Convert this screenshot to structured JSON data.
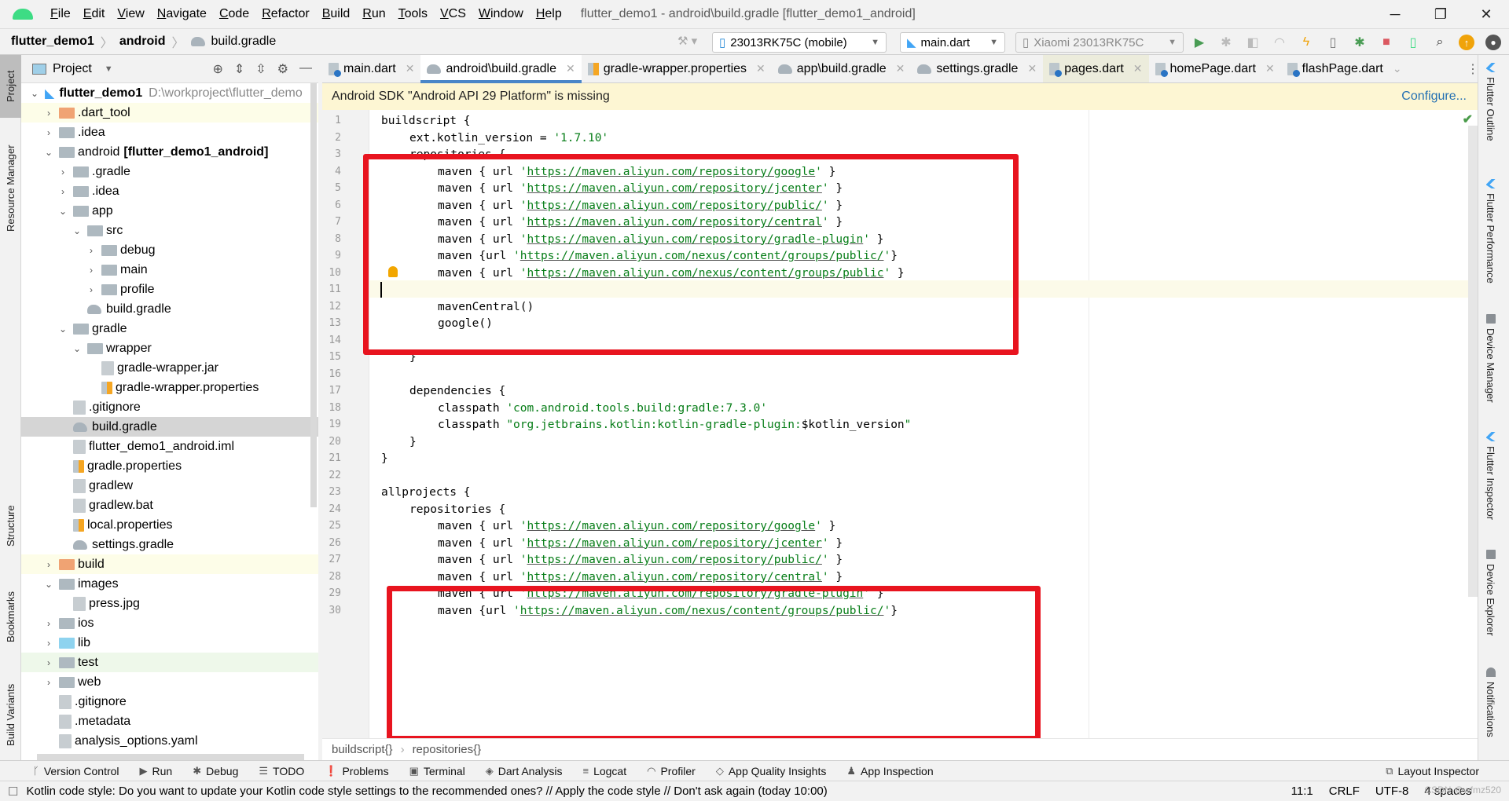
{
  "titlebar": {
    "menu": [
      "File",
      "Edit",
      "View",
      "Navigate",
      "Code",
      "Refactor",
      "Build",
      "Run",
      "Tools",
      "VCS",
      "Window",
      "Help"
    ],
    "window_title": "flutter_demo1 - android\\build.gradle [flutter_demo1_android]"
  },
  "navbar": {
    "breadcrumb": [
      "flutter_demo1",
      "android",
      "build.gradle"
    ],
    "device_combo": "23013RK75C (mobile)",
    "config_combo": "main.dart",
    "target_combo": "Xiaomi 23013RK75C"
  },
  "project_panel": {
    "title": "Project",
    "root_path": "D:\\workproject\\flutter_demo",
    "tree": [
      {
        "label": "flutter_demo1",
        "depth": 0,
        "arrow": "v",
        "icon": "flutter",
        "bold": true
      },
      {
        "label": ".dart_tool",
        "depth": 1,
        "arrow": ">",
        "icon": "folder-orange",
        "hl": "yellow"
      },
      {
        "label": ".idea",
        "depth": 1,
        "arrow": ">",
        "icon": "folder"
      },
      {
        "label": "android",
        "suffix": "[flutter_demo1_android]",
        "depth": 1,
        "arrow": "v",
        "icon": "folder"
      },
      {
        "label": ".gradle",
        "depth": 2,
        "arrow": ">",
        "icon": "folder"
      },
      {
        "label": ".idea",
        "depth": 2,
        "arrow": ">",
        "icon": "folder"
      },
      {
        "label": "app",
        "depth": 2,
        "arrow": "v",
        "icon": "folder"
      },
      {
        "label": "src",
        "depth": 3,
        "arrow": "v",
        "icon": "folder"
      },
      {
        "label": "debug",
        "depth": 4,
        "arrow": ">",
        "icon": "folder"
      },
      {
        "label": "main",
        "depth": 4,
        "arrow": ">",
        "icon": "folder"
      },
      {
        "label": "profile",
        "depth": 4,
        "arrow": ">",
        "icon": "folder"
      },
      {
        "label": "build.gradle",
        "depth": 3,
        "arrow": "",
        "icon": "gradle"
      },
      {
        "label": "gradle",
        "depth": 2,
        "arrow": "v",
        "icon": "folder"
      },
      {
        "label": "wrapper",
        "depth": 3,
        "arrow": "v",
        "icon": "folder"
      },
      {
        "label": "gradle-wrapper.jar",
        "depth": 4,
        "arrow": "",
        "icon": "file"
      },
      {
        "label": "gradle-wrapper.properties",
        "depth": 4,
        "arrow": "",
        "icon": "props"
      },
      {
        "label": ".gitignore",
        "depth": 2,
        "arrow": "",
        "icon": "file"
      },
      {
        "label": "build.gradle",
        "depth": 2,
        "arrow": "",
        "icon": "gradle",
        "sel": true
      },
      {
        "label": "flutter_demo1_android.iml",
        "depth": 2,
        "arrow": "",
        "icon": "file"
      },
      {
        "label": "gradle.properties",
        "depth": 2,
        "arrow": "",
        "icon": "props"
      },
      {
        "label": "gradlew",
        "depth": 2,
        "arrow": "",
        "icon": "file"
      },
      {
        "label": "gradlew.bat",
        "depth": 2,
        "arrow": "",
        "icon": "file"
      },
      {
        "label": "local.properties",
        "depth": 2,
        "arrow": "",
        "icon": "props"
      },
      {
        "label": "settings.gradle",
        "depth": 2,
        "arrow": "",
        "icon": "gradle"
      },
      {
        "label": "build",
        "depth": 1,
        "arrow": ">",
        "icon": "folder-orange",
        "hl": "yellow"
      },
      {
        "label": "images",
        "depth": 1,
        "arrow": "v",
        "icon": "folder"
      },
      {
        "label": "press.jpg",
        "depth": 2,
        "arrow": "",
        "icon": "file"
      },
      {
        "label": "ios",
        "depth": 1,
        "arrow": ">",
        "icon": "folder"
      },
      {
        "label": "lib",
        "depth": 1,
        "arrow": ">",
        "icon": "folder-blue"
      },
      {
        "label": "test",
        "depth": 1,
        "arrow": ">",
        "icon": "folder",
        "hl": "green"
      },
      {
        "label": "web",
        "depth": 1,
        "arrow": ">",
        "icon": "folder"
      },
      {
        "label": ".gitignore",
        "depth": 1,
        "arrow": "",
        "icon": "file"
      },
      {
        "label": ".metadata",
        "depth": 1,
        "arrow": "",
        "icon": "file"
      },
      {
        "label": "analysis_options.yaml",
        "depth": 1,
        "arrow": "",
        "icon": "file"
      }
    ]
  },
  "left_strip": [
    "Project",
    "Resource Manager",
    "Structure",
    "Bookmarks",
    "Build Variants"
  ],
  "tabs": [
    {
      "label": "main.dart",
      "icon": "dart"
    },
    {
      "label": "android\\build.gradle",
      "icon": "gradle",
      "active": true
    },
    {
      "label": "gradle-wrapper.properties",
      "icon": "props"
    },
    {
      "label": "app\\build.gradle",
      "icon": "gradle"
    },
    {
      "label": "settings.gradle",
      "icon": "gradle"
    },
    {
      "label": "pages.dart",
      "icon": "dart",
      "highlight": true
    },
    {
      "label": "homePage.dart",
      "icon": "dart"
    },
    {
      "label": "flashPage.dart",
      "icon": "dart"
    }
  ],
  "banner": {
    "text": "Android SDK \"Android API 29 Platform\" is missing",
    "action": "Configure..."
  },
  "code": [
    {
      "n": 1,
      "t": [
        [
          "",
          "buildscript {"
        ]
      ],
      "ind": 0
    },
    {
      "n": 2,
      "t": [
        [
          "",
          "ext.kotlin_version = "
        ],
        [
          "s",
          "'1.7.10'"
        ]
      ],
      "ind": 1
    },
    {
      "n": 3,
      "t": [
        [
          "",
          "repositories {"
        ]
      ],
      "ind": 1
    },
    {
      "n": 4,
      "t": [
        [
          "",
          "maven { url "
        ],
        [
          "s",
          "'"
        ],
        [
          "u",
          "https://maven.aliyun.com/repository/google"
        ],
        [
          "s",
          "'"
        ],
        [
          "",
          " }"
        ]
      ],
      "ind": 2
    },
    {
      "n": 5,
      "t": [
        [
          "",
          "maven { url "
        ],
        [
          "s",
          "'"
        ],
        [
          "u",
          "https://maven.aliyun.com/repository/jcenter"
        ],
        [
          "s",
          "'"
        ],
        [
          "",
          " }"
        ]
      ],
      "ind": 2
    },
    {
      "n": 6,
      "t": [
        [
          "",
          "maven { url "
        ],
        [
          "s",
          "'"
        ],
        [
          "u",
          "https://maven.aliyun.com/repository/public/"
        ],
        [
          "s",
          "'"
        ],
        [
          "",
          " }"
        ]
      ],
      "ind": 2
    },
    {
      "n": 7,
      "t": [
        [
          "",
          "maven { url "
        ],
        [
          "s",
          "'"
        ],
        [
          "u",
          "https://maven.aliyun.com/repository/central"
        ],
        [
          "s",
          "'"
        ],
        [
          "",
          " }"
        ]
      ],
      "ind": 2
    },
    {
      "n": 8,
      "t": [
        [
          "",
          "maven { url "
        ],
        [
          "s",
          "'"
        ],
        [
          "u",
          "https://maven.aliyun.com/repository/gradle-plugin"
        ],
        [
          "s",
          "'"
        ],
        [
          "",
          " }"
        ]
      ],
      "ind": 2
    },
    {
      "n": 9,
      "t": [
        [
          "",
          "maven {url "
        ],
        [
          "s",
          "'"
        ],
        [
          "u",
          "https://maven.aliyun.com/nexus/content/groups/public/"
        ],
        [
          "s",
          "'"
        ],
        [
          "",
          "}"
        ]
      ],
      "ind": 2
    },
    {
      "n": 10,
      "t": [
        [
          "",
          "maven { url "
        ],
        [
          "s",
          "'"
        ],
        [
          "u",
          "https://maven.aliyun.com/nexus/content/groups/public"
        ],
        [
          "s",
          "'"
        ],
        [
          "",
          " }"
        ]
      ],
      "ind": 2
    },
    {
      "n": 11,
      "t": [],
      "ind": 0
    },
    {
      "n": 12,
      "t": [
        [
          "",
          "mavenCentral()"
        ]
      ],
      "ind": 2
    },
    {
      "n": 13,
      "t": [
        [
          "",
          "google()"
        ]
      ],
      "ind": 2
    },
    {
      "n": 14,
      "t": [],
      "ind": 0
    },
    {
      "n": 15,
      "t": [
        [
          "",
          "}"
        ]
      ],
      "ind": 1
    },
    {
      "n": 16,
      "t": [],
      "ind": 0
    },
    {
      "n": 17,
      "t": [
        [
          "",
          "dependencies {"
        ]
      ],
      "ind": 1
    },
    {
      "n": 18,
      "t": [
        [
          "",
          "classpath "
        ],
        [
          "s",
          "'com.android.tools.build:gradle:7.3.0'"
        ]
      ],
      "ind": 2
    },
    {
      "n": 19,
      "t": [
        [
          "",
          "classpath "
        ],
        [
          "s",
          "\"org.jetbrains.kotlin:kotlin-gradle-plugin:"
        ],
        [
          "",
          "$kotlin_version"
        ],
        [
          "s",
          "\""
        ]
      ],
      "ind": 2
    },
    {
      "n": 20,
      "t": [
        [
          "",
          "}"
        ]
      ],
      "ind": 1
    },
    {
      "n": 21,
      "t": [
        [
          "",
          "}"
        ]
      ],
      "ind": 0
    },
    {
      "n": 22,
      "t": [],
      "ind": 0
    },
    {
      "n": 23,
      "t": [
        [
          "",
          "allprojects {"
        ]
      ],
      "ind": 0
    },
    {
      "n": 24,
      "t": [
        [
          "",
          "repositories {"
        ]
      ],
      "ind": 1
    },
    {
      "n": 25,
      "t": [
        [
          "",
          "maven { url "
        ],
        [
          "s",
          "'"
        ],
        [
          "u",
          "https://maven.aliyun.com/repository/google"
        ],
        [
          "s",
          "'"
        ],
        [
          "",
          " }"
        ]
      ],
      "ind": 2
    },
    {
      "n": 26,
      "t": [
        [
          "",
          "maven { url "
        ],
        [
          "s",
          "'"
        ],
        [
          "u",
          "https://maven.aliyun.com/repository/jcenter"
        ],
        [
          "s",
          "'"
        ],
        [
          "",
          " }"
        ]
      ],
      "ind": 2
    },
    {
      "n": 27,
      "t": [
        [
          "",
          "maven { url "
        ],
        [
          "s",
          "'"
        ],
        [
          "u",
          "https://maven.aliyun.com/repository/public/"
        ],
        [
          "s",
          "'"
        ],
        [
          "",
          " }"
        ]
      ],
      "ind": 2
    },
    {
      "n": 28,
      "t": [
        [
          "",
          "maven { url "
        ],
        [
          "s",
          "'"
        ],
        [
          "u",
          "https://maven.aliyun.com/repository/central"
        ],
        [
          "s",
          "'"
        ],
        [
          "",
          " }"
        ]
      ],
      "ind": 2
    },
    {
      "n": 29,
      "t": [
        [
          "",
          "maven { url "
        ],
        [
          "s",
          "'"
        ],
        [
          "u",
          "https://maven.aliyun.com/repository/gradle-plugin"
        ],
        [
          "s",
          "'"
        ],
        [
          "",
          " }"
        ]
      ],
      "ind": 2
    },
    {
      "n": 30,
      "t": [
        [
          "",
          "maven {url "
        ],
        [
          "s",
          "'"
        ],
        [
          "u",
          "https://maven.aliyun.com/nexus/content/groups/public/"
        ],
        [
          "s",
          "'"
        ],
        [
          "",
          "}"
        ]
      ],
      "ind": 2
    }
  ],
  "editor_breadcrumb": [
    "buildscript{}",
    "repositories{}"
  ],
  "right_strip": [
    "Flutter Outline",
    "Flutter Performance",
    "Device Manager",
    "Flutter Inspector",
    "Device Explorer",
    "Notifications"
  ],
  "bottom_tools": [
    "Version Control",
    "Run",
    "Debug",
    "TODO",
    "Problems",
    "Terminal",
    "Dart Analysis",
    "Logcat",
    "Profiler",
    "App Quality Insights",
    "App Inspection"
  ],
  "layout_inspector": "Layout Inspector",
  "status": {
    "message": "Kotlin code style: Do you want to update your Kotlin code style settings to the recommended ones? // Apply the code style // Don't ask again (today 10:00)",
    "position": "11:1",
    "line_sep": "CRLF",
    "encoding": "UTF-8",
    "indent": "4 spaces",
    "watermark": "CSDN @wfmz520"
  },
  "colors": {
    "accent": "#4a86c8",
    "annotation_red": "#e8141f",
    "string_green": "#067d17",
    "banner_bg": "#fdf6d3"
  }
}
